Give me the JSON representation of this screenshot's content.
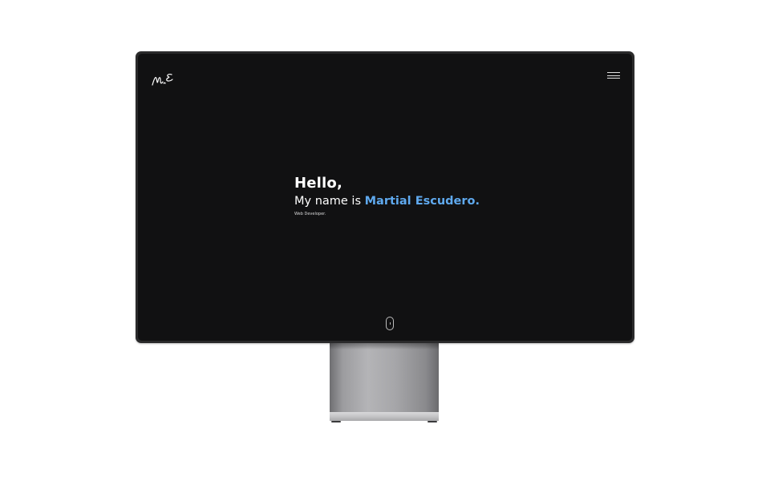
{
  "header": {
    "logo": "ME",
    "menu_icon": "hamburger-menu-icon"
  },
  "hero": {
    "greeting": "Hello,",
    "intro_prefix": "My name is ",
    "name": "Martial Escudero.",
    "role": "Web Developer."
  },
  "scroll_indicator": {
    "icon": "mouse-scroll-icon"
  },
  "colors": {
    "screen_background": "#111112",
    "accent": "#5fa9ee",
    "text": "#ffffff"
  }
}
